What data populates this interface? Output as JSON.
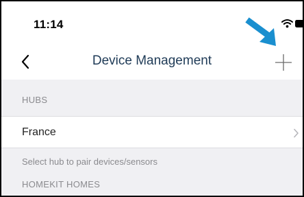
{
  "status_bar": {
    "time": "11:14",
    "icons": [
      "wifi-icon",
      "battery-icon"
    ]
  },
  "nav": {
    "title": "Device Management",
    "back_icon": "chevron-left-icon",
    "add_icon": "plus-icon"
  },
  "annotation": {
    "icon": "arrow-icon",
    "color": "#1a8fcf"
  },
  "sections": {
    "hubs": {
      "header": "HUBS",
      "items": [
        {
          "label": "France",
          "icon": "chevron-right-icon"
        }
      ],
      "footer": "Select hub to pair devices/sensors"
    },
    "homekit": {
      "header": "HOMEKIT HOMES"
    }
  },
  "colors": {
    "title": "#1f3b57",
    "background": "#f0f0f3",
    "secondary_text": "#8a8a8e"
  }
}
